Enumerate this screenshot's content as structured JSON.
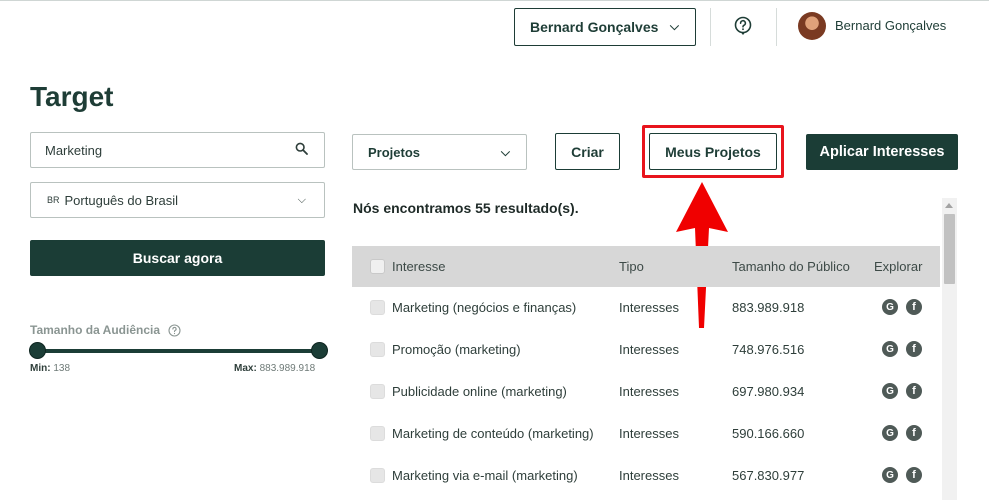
{
  "header": {
    "account_selector": "Bernard Gonçalves",
    "user_name": "Bernard Gonçalves"
  },
  "page_title": "Target",
  "search": {
    "value": "Marketing",
    "placeholder": ""
  },
  "language": {
    "code": "BR",
    "label": "Português do Brasil"
  },
  "buscar_label": "Buscar agora",
  "audience": {
    "label": "Tamanho da Audiência",
    "min_label": "Min:",
    "min_value": "138",
    "max_label": "Max:",
    "max_value": "883.989.918"
  },
  "controls": {
    "projects_select": "Projetos",
    "criar_label": "Criar",
    "meus_projetos_label": "Meus Projetos",
    "aplicar_label": "Aplicar Interesses"
  },
  "results_text": "Nós encontramos 55 resultado(s).",
  "table": {
    "columns": [
      "Interesse",
      "Tipo",
      "Tamanho do Público",
      "Explorar"
    ],
    "rows": [
      {
        "interesse": "Marketing (negócios e finanças)",
        "tipo": "Interesses",
        "tamanho": "883.989.918"
      },
      {
        "interesse": "Promoção (marketing)",
        "tipo": "Interesses",
        "tamanho": "748.976.516"
      },
      {
        "interesse": "Publicidade online (marketing)",
        "tipo": "Interesses",
        "tamanho": "697.980.934"
      },
      {
        "interesse": "Marketing de conteúdo (marketing)",
        "tipo": "Interesses",
        "tamanho": "590.166.660"
      },
      {
        "interesse": "Marketing via e-mail (marketing)",
        "tipo": "Interesses",
        "tamanho": "567.830.977"
      }
    ]
  },
  "icons": {
    "google": "G",
    "facebook": "f"
  },
  "colors": {
    "primary": "#1b3d36",
    "highlight": "#e8141c"
  }
}
